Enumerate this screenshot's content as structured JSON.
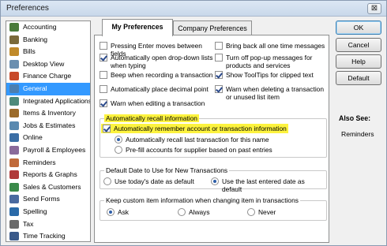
{
  "window": {
    "title": "Preferences",
    "close_label": "⊠"
  },
  "sidebar": {
    "items": [
      {
        "label": "Accounting",
        "icon": "accounting-icon",
        "color": "#4a7b3a"
      },
      {
        "label": "Banking",
        "icon": "banking-icon",
        "color": "#7a6a3a"
      },
      {
        "label": "Bills",
        "icon": "bills-icon",
        "color": "#c08a2a"
      },
      {
        "label": "Desktop View",
        "icon": "desktop-view-icon",
        "color": "#6a8fb0"
      },
      {
        "label": "Finance Charge",
        "icon": "finance-charge-icon",
        "color": "#c84a2a"
      },
      {
        "label": "General",
        "icon": "general-icon",
        "color": "#4c7fb0"
      },
      {
        "label": "Integrated Applications",
        "icon": "integrated-apps-icon",
        "color": "#4d8a7a"
      },
      {
        "label": "Items & Inventory",
        "icon": "items-inventory-icon",
        "color": "#9b6b2a"
      },
      {
        "label": "Jobs & Estimates",
        "icon": "jobs-estimates-icon",
        "color": "#5a8ab0"
      },
      {
        "label": "Online",
        "icon": "online-icon",
        "color": "#3a6ea5"
      },
      {
        "label": "Payroll & Employees",
        "icon": "payroll-icon",
        "color": "#8a6a9a"
      },
      {
        "label": "Reminders",
        "icon": "reminders-icon",
        "color": "#c06a3a"
      },
      {
        "label": "Reports & Graphs",
        "icon": "reports-graphs-icon",
        "color": "#b03a3a"
      },
      {
        "label": "Sales & Customers",
        "icon": "sales-customers-icon",
        "color": "#3a8a4a"
      },
      {
        "label": "Send Forms",
        "icon": "send-forms-icon",
        "color": "#4a6aa0"
      },
      {
        "label": "Spelling",
        "icon": "spelling-icon",
        "color": "#2a6aa8"
      },
      {
        "label": "Tax",
        "icon": "tax-icon",
        "color": "#6a6a6a"
      },
      {
        "label": "Time Tracking",
        "icon": "time-tracking-icon",
        "color": "#3a5a8a"
      }
    ],
    "active_index": 5
  },
  "tabs": [
    {
      "label": "My Preferences",
      "active": true
    },
    {
      "label": "Company Preferences",
      "active": false
    }
  ],
  "prefs": {
    "left": [
      {
        "label": "Pressing Enter moves between fields",
        "checked": false
      },
      {
        "label": "Automatically open drop-down lists when typing",
        "checked": true
      },
      {
        "label": "Beep when recording a transaction",
        "checked": false
      },
      {
        "label": "Automatically place decimal point",
        "checked": false
      },
      {
        "label": "Warn when editing a transaction",
        "checked": true
      }
    ],
    "right": [
      {
        "label": "Bring back all one time messages",
        "checked": false
      },
      {
        "label": "Turn off pop-up messages for products and services",
        "checked": false
      },
      {
        "label": "Show ToolTips for clipped text",
        "checked": true
      },
      {
        "label": "Warn when deleting a transaction or unused list item",
        "checked": true
      }
    ]
  },
  "recall": {
    "group_label": "Automatically recall information",
    "main_label": "Automatically remember account or transaction information",
    "main_checked": true,
    "options": [
      {
        "label": "Automatically recall last transaction for this name",
        "checked": true
      },
      {
        "label": "Pre-fill accounts for supplier based on past entries",
        "checked": false
      }
    ]
  },
  "default_date": {
    "group_label": "Default Date to Use for New Transactions",
    "options": [
      {
        "label": "Use today's date as default",
        "checked": false
      },
      {
        "label": "Use the last entered date as default",
        "checked": true
      }
    ]
  },
  "custom_info": {
    "group_label": "Keep custom item information when changing item in transactions",
    "options": [
      {
        "label": "Ask",
        "checked": true
      },
      {
        "label": "Always",
        "checked": false
      },
      {
        "label": "Never",
        "checked": false
      }
    ]
  },
  "buttons": {
    "ok": "OK",
    "cancel": "Cancel",
    "help": "Help",
    "default": "Default"
  },
  "also_see": {
    "heading": "Also See:",
    "link": "Reminders"
  },
  "colors": {
    "active_blue": "#3399ff",
    "highlight_yellow": "#fdf33f"
  }
}
